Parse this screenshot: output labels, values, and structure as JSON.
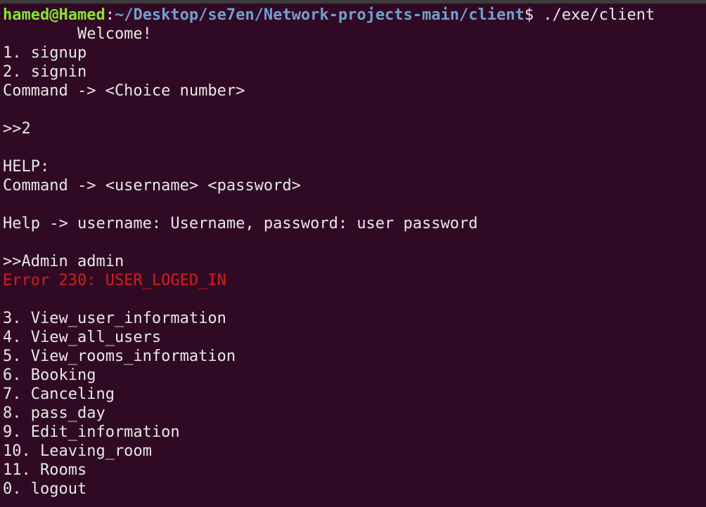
{
  "colors": {
    "background": "#300a24",
    "prompt_user": "#8ae234",
    "prompt_path": "#729fcf",
    "text": "#e8e8e8",
    "error": "#d21f1f"
  },
  "prompt": {
    "user_host": "hamed@Hamed",
    "separator": ":",
    "path": "~/Desktop/se7en/Network-projects-main/client",
    "symbol": "$",
    "command": " ./exe/client"
  },
  "lines": [
    "        Welcome!",
    "1. signup",
    "2. signin",
    "Command -> <Choice number>",
    "",
    ">>2",
    "",
    "HELP:",
    "Command -> <username> <password>",
    "",
    "Help -> username: Username, password: user password",
    "",
    ">>Admin admin"
  ],
  "error_line": "Error 230: USER_LOGED_IN",
  "menu_blank": "",
  "menu_items": [
    "3. View_user_information",
    "4. View_all_users",
    "5. View_rooms_information",
    "6. Booking",
    "7. Canceling",
    "8. pass_day",
    "9. Edit_information",
    "10. Leaving_room",
    "11. Rooms",
    "0. logout"
  ]
}
